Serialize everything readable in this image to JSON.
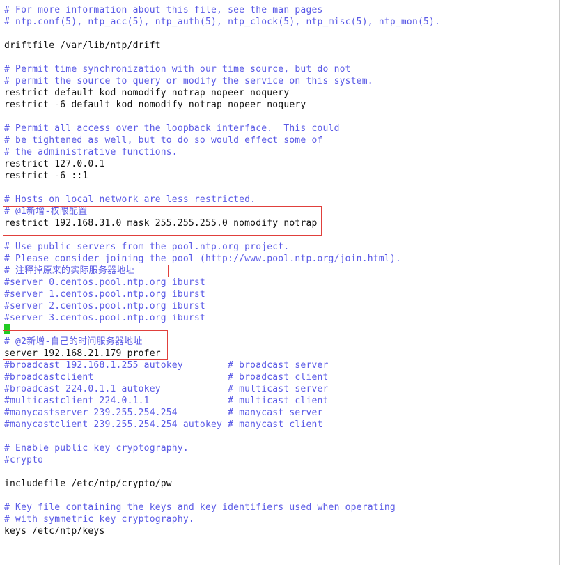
{
  "editor": {
    "lines": [
      {
        "text": "# For more information about this file, see the man pages",
        "kind": "comment"
      },
      {
        "text": "# ntp.conf(5), ntp_acc(5), ntp_auth(5), ntp_clock(5), ntp_misc(5), ntp_mon(5).",
        "kind": "comment"
      },
      {
        "text": "",
        "kind": "blank"
      },
      {
        "text": "driftfile /var/lib/ntp/drift",
        "kind": "code"
      },
      {
        "text": "",
        "kind": "blank"
      },
      {
        "text": "# Permit time synchronization with our time source, but do not",
        "kind": "comment"
      },
      {
        "text": "# permit the source to query or modify the service on this system.",
        "kind": "comment"
      },
      {
        "text": "restrict default kod nomodify notrap nopeer noquery",
        "kind": "code"
      },
      {
        "text": "restrict -6 default kod nomodify notrap nopeer noquery",
        "kind": "code"
      },
      {
        "text": "",
        "kind": "blank"
      },
      {
        "text": "# Permit all access over the loopback interface.  This could",
        "kind": "comment"
      },
      {
        "text": "# be tightened as well, but to do so would effect some of",
        "kind": "comment"
      },
      {
        "text": "# the administrative functions.",
        "kind": "comment"
      },
      {
        "text": "restrict 127.0.0.1",
        "kind": "code"
      },
      {
        "text": "restrict -6 ::1",
        "kind": "code"
      },
      {
        "text": "",
        "kind": "blank"
      },
      {
        "text": "# Hosts on local network are less restricted.",
        "kind": "comment"
      },
      {
        "text": "# @1新增-权限配置",
        "kind": "comment"
      },
      {
        "text": "restrict 192.168.31.0 mask 255.255.255.0 nomodify notrap",
        "kind": "code"
      },
      {
        "text": "",
        "kind": "blank"
      },
      {
        "text": "# Use public servers from the pool.ntp.org project.",
        "kind": "comment"
      },
      {
        "text": "# Please consider joining the pool (http://www.pool.ntp.org/join.html).",
        "kind": "comment"
      },
      {
        "text": "# 注释掉原来的实际服务器地址",
        "kind": "comment"
      },
      {
        "text": "#server 0.centos.pool.ntp.org iburst",
        "kind": "comment"
      },
      {
        "text": "#server 1.centos.pool.ntp.org iburst",
        "kind": "comment"
      },
      {
        "text": "#server 2.centos.pool.ntp.org iburst",
        "kind": "comment"
      },
      {
        "text": "#server 3.centos.pool.ntp.org iburst",
        "kind": "comment"
      },
      {
        "text": "",
        "kind": "blank"
      },
      {
        "text": "# @2新增-自己的时间服务器地址",
        "kind": "comment"
      },
      {
        "text": "server 192.168.21.179 profer",
        "kind": "code"
      },
      {
        "text": "#broadcast 192.168.1.255 autokey        # broadcast server",
        "kind": "comment"
      },
      {
        "text": "#broadcastclient                        # broadcast client",
        "kind": "comment"
      },
      {
        "text": "#broadcast 224.0.1.1 autokey            # multicast server",
        "kind": "comment"
      },
      {
        "text": "#multicastclient 224.0.1.1              # multicast client",
        "kind": "comment"
      },
      {
        "text": "#manycastserver 239.255.254.254         # manycast server",
        "kind": "comment"
      },
      {
        "text": "#manycastclient 239.255.254.254 autokey # manycast client",
        "kind": "comment"
      },
      {
        "text": "",
        "kind": "blank"
      },
      {
        "text": "# Enable public key cryptography.",
        "kind": "comment"
      },
      {
        "text": "#crypto",
        "kind": "comment"
      },
      {
        "text": "",
        "kind": "blank"
      },
      {
        "text": "includefile /etc/ntp/crypto/pw",
        "kind": "code"
      },
      {
        "text": "",
        "kind": "blank"
      },
      {
        "text": "# Key file containing the keys and key identifiers used when operating",
        "kind": "comment"
      },
      {
        "text": "# with symmetric key cryptography.",
        "kind": "comment"
      },
      {
        "text": "keys /etc/ntp/keys",
        "kind": "code"
      },
      {
        "text": "",
        "kind": "blank"
      },
      {
        "text": "",
        "kind": "blank"
      },
      {
        "text": "",
        "kind": "blank"
      }
    ]
  },
  "colors": {
    "comment": "#5a5ae6",
    "code": "#111111",
    "highlight_box": "#e0403c",
    "cursor": "#22cc22",
    "background": "#ffffff"
  }
}
